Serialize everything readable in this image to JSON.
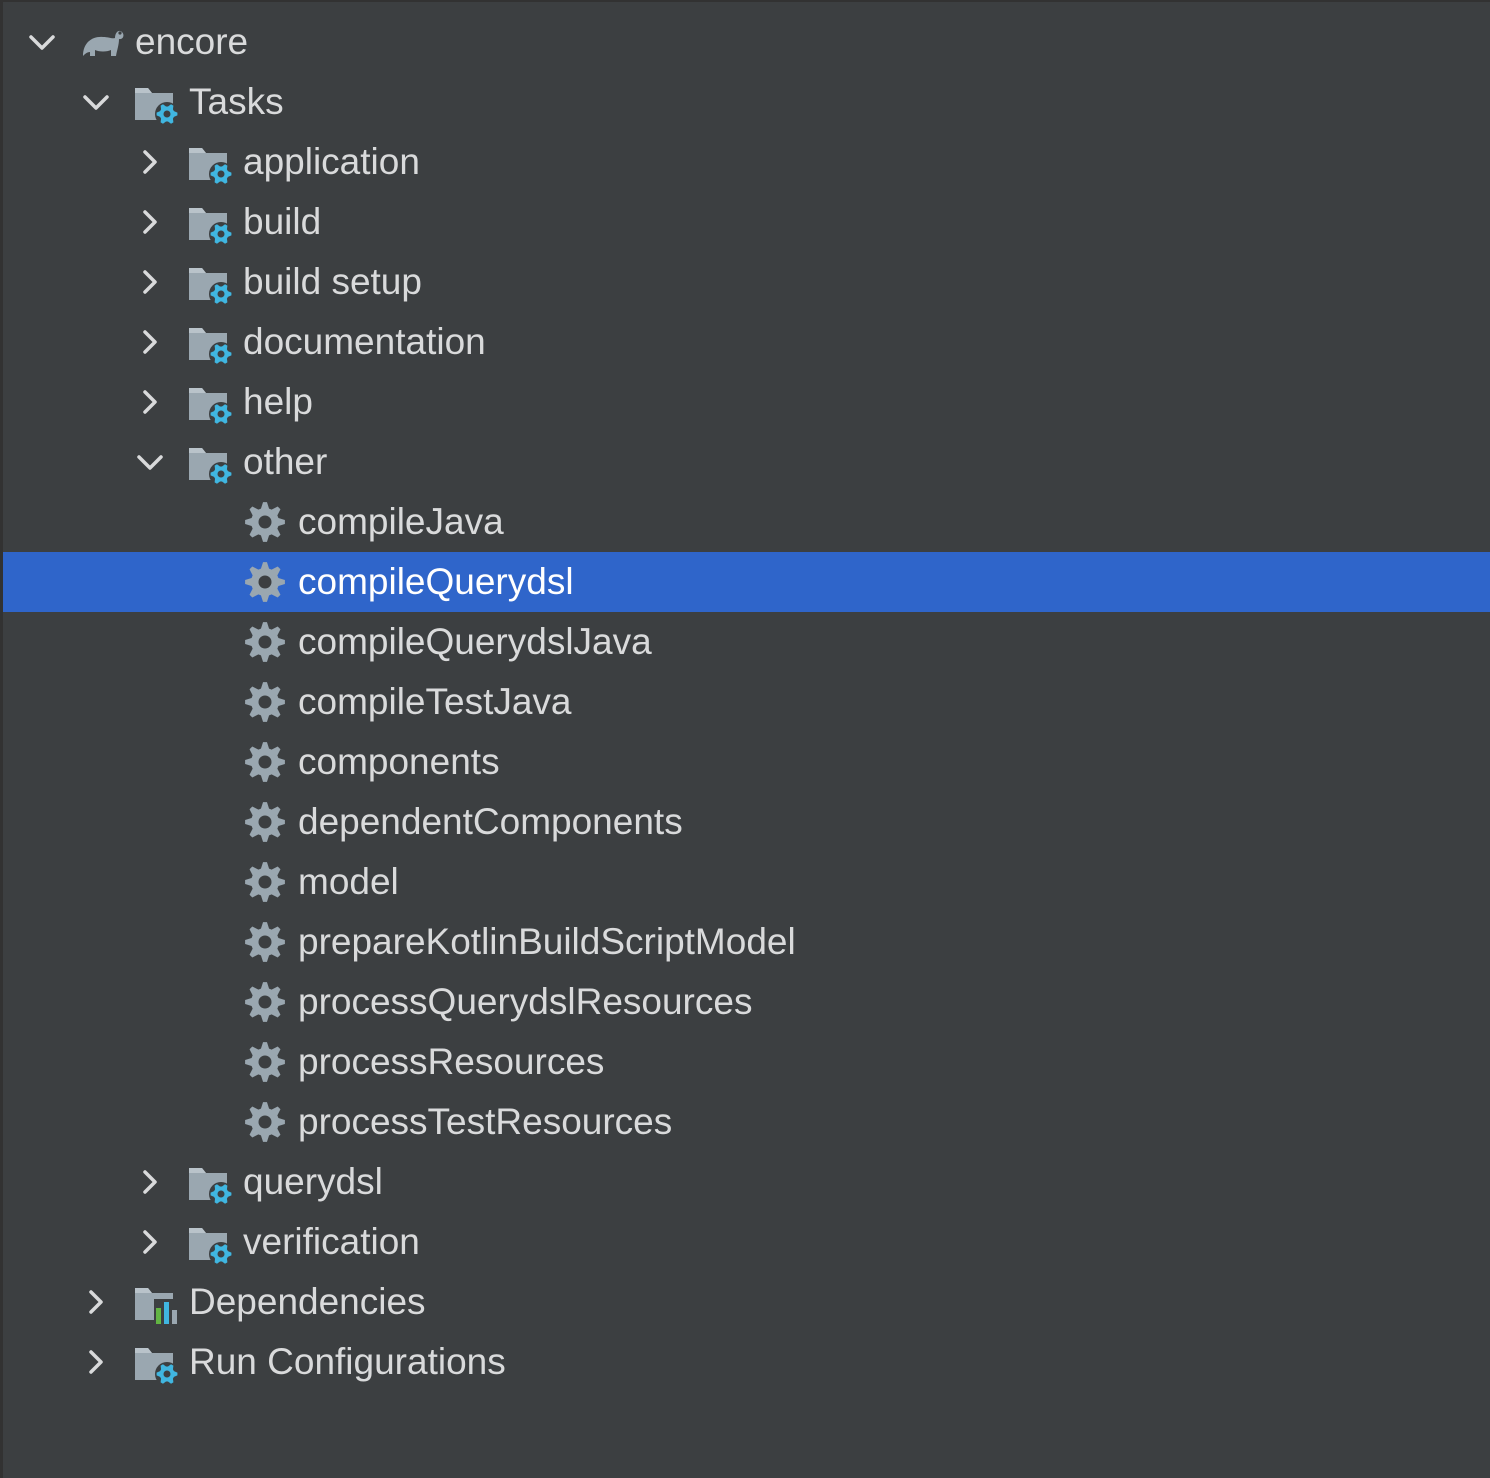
{
  "tree": {
    "rows": [
      {
        "label": "encore",
        "icon": "gradle-elephant-icon",
        "arrow": "expanded",
        "level": 0
      },
      {
        "label": "Tasks",
        "icon": "task-folder-icon",
        "arrow": "expanded",
        "level": 1
      },
      {
        "label": "application",
        "icon": "task-folder-icon",
        "arrow": "collapsed",
        "level": 2
      },
      {
        "label": "build",
        "icon": "task-folder-icon",
        "arrow": "collapsed",
        "level": 2
      },
      {
        "label": "build setup",
        "icon": "task-folder-icon",
        "arrow": "collapsed",
        "level": 2
      },
      {
        "label": "documentation",
        "icon": "task-folder-icon",
        "arrow": "collapsed",
        "level": 2
      },
      {
        "label": "help",
        "icon": "task-folder-icon",
        "arrow": "collapsed",
        "level": 2
      },
      {
        "label": "other",
        "icon": "task-folder-icon",
        "arrow": "expanded",
        "level": 2
      },
      {
        "label": "compileJava",
        "icon": "gear-icon",
        "arrow": "none",
        "level": 3
      },
      {
        "label": "compileQuerydsl",
        "icon": "gear-icon",
        "arrow": "none",
        "level": 3,
        "selected": true
      },
      {
        "label": "compileQuerydslJava",
        "icon": "gear-icon",
        "arrow": "none",
        "level": 3
      },
      {
        "label": "compileTestJava",
        "icon": "gear-icon",
        "arrow": "none",
        "level": 3
      },
      {
        "label": "components",
        "icon": "gear-icon",
        "arrow": "none",
        "level": 3
      },
      {
        "label": "dependentComponents",
        "icon": "gear-icon",
        "arrow": "none",
        "level": 3
      },
      {
        "label": "model",
        "icon": "gear-icon",
        "arrow": "none",
        "level": 3
      },
      {
        "label": "prepareKotlinBuildScriptModel",
        "icon": "gear-icon",
        "arrow": "none",
        "level": 3
      },
      {
        "label": "processQuerydslResources",
        "icon": "gear-icon",
        "arrow": "none",
        "level": 3
      },
      {
        "label": "processResources",
        "icon": "gear-icon",
        "arrow": "none",
        "level": 3
      },
      {
        "label": "processTestResources",
        "icon": "gear-icon",
        "arrow": "none",
        "level": 3
      },
      {
        "label": "querydsl",
        "icon": "task-folder-icon",
        "arrow": "collapsed",
        "level": 2
      },
      {
        "label": "verification",
        "icon": "task-folder-icon",
        "arrow": "collapsed",
        "level": 2
      },
      {
        "label": "Dependencies",
        "icon": "dependencies-folder-icon",
        "arrow": "collapsed",
        "level": 1
      },
      {
        "label": "Run Configurations",
        "icon": "task-folder-icon",
        "arrow": "collapsed",
        "level": 1
      }
    ]
  },
  "colors": {
    "background": "#3c3f41",
    "text": "#d9dadb",
    "selection": "#2f65ca",
    "icon_gray": "#9aa7b0",
    "gear_blue": "#40b6e0",
    "chart_green": "#62b543"
  }
}
